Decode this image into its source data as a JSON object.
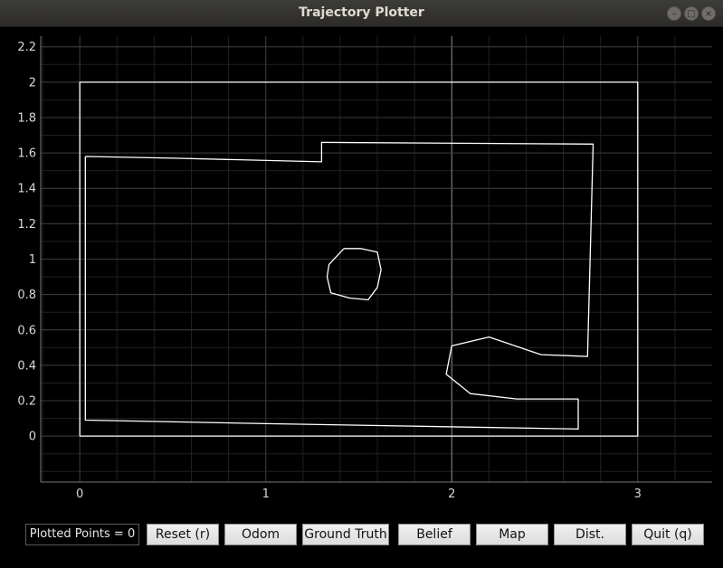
{
  "window": {
    "title": "Trajectory Plotter"
  },
  "status": {
    "plotted_points": "Plotted Points = 0"
  },
  "buttons": {
    "reset": "Reset (r)",
    "odom": "Odom",
    "ground_truth": "Ground Truth",
    "belief": "Belief",
    "map": "Map",
    "dist": "Dist.",
    "quit": "Quit (q)"
  },
  "chart_data": {
    "type": "line",
    "xlim": [
      -0.21,
      3.4
    ],
    "ylim": [
      -0.26,
      2.26
    ],
    "x_ticks": [
      0,
      1,
      2,
      3
    ],
    "y_ticks": [
      0,
      0.2,
      0.4,
      0.6,
      0.8,
      1,
      1.2,
      1.4,
      1.6,
      1.8,
      2,
      2.2
    ],
    "x_tick_labels": [
      "0",
      "1",
      "2",
      "3"
    ],
    "y_tick_labels": [
      "0",
      "0.2",
      "0.4",
      "0.6",
      "0.8",
      "1",
      "1.2",
      "1.4",
      "1.6",
      "1.8",
      "2",
      "2.2"
    ],
    "grid": true,
    "series": [
      {
        "values": [
          [
            0,
            0
          ],
          [
            3,
            0
          ],
          [
            3,
            2
          ],
          [
            0,
            2
          ],
          [
            0,
            0
          ]
        ]
      },
      {
        "values": [
          [
            0.03,
            1.58
          ],
          [
            0.53,
            1.57
          ],
          [
            1.3,
            1.55
          ],
          [
            1.3,
            1.66
          ],
          [
            2.76,
            1.65
          ],
          [
            2.73,
            0.45
          ],
          [
            2.48,
            0.46
          ],
          [
            2.2,
            0.56
          ],
          [
            2.0,
            0.51
          ],
          [
            1.97,
            0.35
          ],
          [
            2.1,
            0.24
          ],
          [
            2.35,
            0.21
          ],
          [
            2.68,
            0.21
          ],
          [
            2.68,
            0.04
          ],
          [
            1.0,
            0.07
          ],
          [
            0.03,
            0.09
          ],
          [
            0.03,
            1.58
          ]
        ]
      },
      {
        "values": [
          [
            1.42,
            1.06
          ],
          [
            1.51,
            1.06
          ],
          [
            1.6,
            1.04
          ],
          [
            1.62,
            0.94
          ],
          [
            1.6,
            0.84
          ],
          [
            1.55,
            0.77
          ],
          [
            1.45,
            0.78
          ],
          [
            1.35,
            0.81
          ],
          [
            1.33,
            0.9
          ],
          [
            1.34,
            0.97
          ],
          [
            1.42,
            1.06
          ]
        ]
      }
    ]
  }
}
